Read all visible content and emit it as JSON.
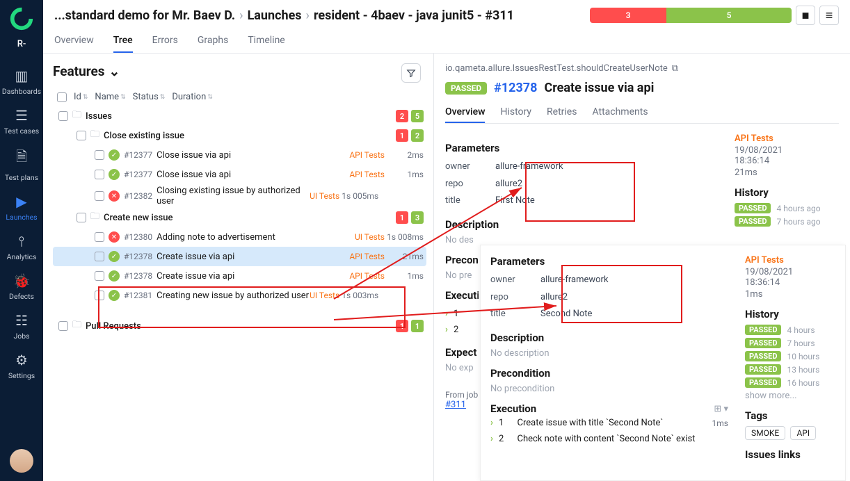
{
  "sidebar": {
    "user_tag": "R-",
    "items": [
      {
        "label": "Dashboards"
      },
      {
        "label": "Test cases"
      },
      {
        "label": "Test plans"
      },
      {
        "label": "Launches"
      },
      {
        "label": "Analytics"
      },
      {
        "label": "Defects"
      },
      {
        "label": "Jobs"
      },
      {
        "label": "Settings"
      }
    ]
  },
  "breadcrumb": {
    "p1": "...standard demo for Mr. Baev D.",
    "p2": "Launches",
    "p3": "resident - 4baev - java junit5 - #311"
  },
  "progress": {
    "fail": "3",
    "pass": "5"
  },
  "tabs": [
    "Overview",
    "Tree",
    "Errors",
    "Graphs",
    "Timeline"
  ],
  "panel_title": "Features",
  "columns": {
    "id": "Id",
    "name": "Name",
    "status": "Status",
    "duration": "Duration"
  },
  "groups": {
    "issues": "Issues",
    "issues_badges": {
      "fail": "2",
      "pass": "5"
    },
    "close": "Close existing issue",
    "close_badges": {
      "fail": "1",
      "pass": "2"
    },
    "create": "Create new issue",
    "create_badges": {
      "fail": "1",
      "pass": "3"
    },
    "pull": "Pull Requests",
    "pull_badges": {
      "fail": "1",
      "pass": "1"
    }
  },
  "tests": {
    "t1": {
      "id": "#12377",
      "name": "Close issue via api",
      "tag": "API Tests",
      "dur": "2ms"
    },
    "t2": {
      "id": "#12377",
      "name": "Close issue via api",
      "tag": "API Tests",
      "dur": "1ms"
    },
    "t3": {
      "id": "#12382",
      "name": "Closing existing issue by authorized user",
      "tag": "UI Tests",
      "dur": "1s 005ms"
    },
    "t4": {
      "id": "#12380",
      "name": "Adding note to advertisement",
      "tag": "UI Tests",
      "dur": "1s 008ms"
    },
    "t5": {
      "id": "#12378",
      "name": "Create issue via api",
      "tag": "API Tests",
      "dur": "21ms"
    },
    "t6": {
      "id": "#12378",
      "name": "Create issue via api",
      "tag": "API Tests",
      "dur": "1ms"
    },
    "t7": {
      "id": "#12381",
      "name": "Creating new issue by authorized user",
      "tag": "UI Tests",
      "dur": "1s 003ms"
    }
  },
  "detail": {
    "fqn": "io.qameta.allure.IssuesRestTest.shouldCreateUserNote",
    "status": "PASSED",
    "link": "#12378",
    "title": "Create issue via api",
    "tabs": [
      "Overview",
      "History",
      "Retries",
      "Attachments"
    ],
    "params_h": "Parameters",
    "params": {
      "owner": "allure-framework",
      "repo": "allure2",
      "title": "First Note"
    },
    "desc_h": "Description",
    "no_desc": "No description",
    "precond_h": "Precondition",
    "no_precond": "No precondition",
    "exec_h": "Execution",
    "step1": "1",
    "step2": "2",
    "expect_h": "Expected result",
    "no_expect": "No expected result",
    "meta_tag": "API Tests",
    "meta_date": "19/08/2021",
    "meta_time": "18:36:14",
    "meta_dur": "21ms",
    "history_h": "History",
    "hist1_when": "4 hours ago",
    "hist2_when": "7 hours ago",
    "from_label": "From job",
    "from_link": "#311"
  },
  "overlay": {
    "params_h": "Parameters",
    "params": {
      "owner": "allure-framework",
      "repo": "allure2",
      "title": "Second Note"
    },
    "desc_h": "Description",
    "no_desc": "No description",
    "precond_h": "Precondition",
    "no_precond": "No precondition",
    "exec_h": "Execution",
    "step1_num": "1",
    "step1": "Create issue with title `Second Note`",
    "step1_dur": "1ms",
    "step2_num": "2",
    "step2": "Check note with content `Second Note` exist",
    "meta_tag": "API Tests",
    "meta_date": "19/08/2021",
    "meta_time": "18:36:14",
    "meta_dur": "1ms",
    "history_h": "History",
    "hist": [
      {
        "status": "PASSED",
        "when": "4 hours"
      },
      {
        "status": "PASSED",
        "when": "7 hours"
      },
      {
        "status": "PASSED",
        "when": "10 hours"
      },
      {
        "status": "PASSED",
        "when": "13 hours"
      },
      {
        "status": "PASSED",
        "when": "16 hours"
      }
    ],
    "show_more": "show more...",
    "tags_h": "Tags",
    "tag1": "SMOKE",
    "tag2": "API",
    "issues_links": "Issues links"
  }
}
